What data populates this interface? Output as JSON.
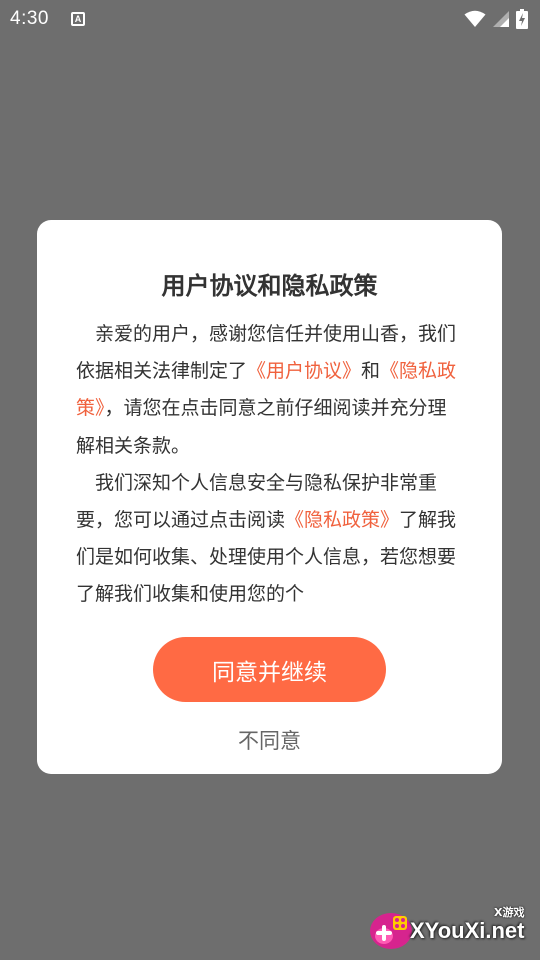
{
  "status_bar": {
    "time": "4:30",
    "icons": [
      "notification-a-icon",
      "wifi-icon",
      "signal-icon",
      "battery-charging-icon"
    ]
  },
  "dialog": {
    "title": "用户协议和隐私政策",
    "paragraph1": {
      "line1": "亲爱的用户，感谢您信任并使用山香，",
      "line2_text": "我们依据相关法律制定了",
      "line2_link": "《用户协议》",
      "line2_suffix": "和",
      "line3_link": "《隐私政策》",
      "line3_text": "，请您在点击同意之前仔细",
      "line4": "阅读并充分理解相关条款。"
    },
    "paragraph2": {
      "line1": "我们深知个人信息安全与隐私保护非常",
      "line2_text": "重要，您可以通过点击阅读",
      "line2_link": "《隐私政策》",
      "line3": "了解我们是如何收集、处理使用个人信",
      "line4": "息，若您想要了解我们收集和使用您的个"
    },
    "agree_label": "同意并继续",
    "disagree_label": "不同意"
  },
  "watermark": {
    "small_text": "X游戏",
    "text": "XYouXi.net"
  },
  "colors": {
    "overlay": "#6e6e6e",
    "accent": "#ff6a44",
    "link": "#f0613d"
  }
}
